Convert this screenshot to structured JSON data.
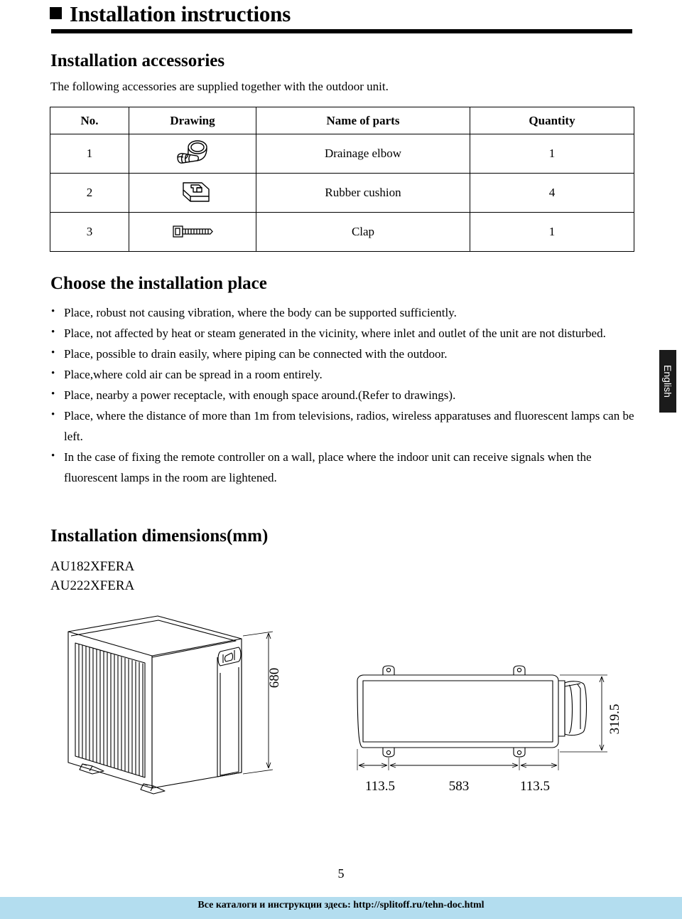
{
  "page": {
    "title": "Installation instructions",
    "page_number": "5",
    "language_tab": "English"
  },
  "accessories_section": {
    "heading": "Installation accessories",
    "intro": "The following accessories are supplied together with the outdoor unit.",
    "table": {
      "headers": [
        "No.",
        "Drawing",
        "Name of parts",
        "Quantity"
      ],
      "rows": [
        {
          "no": "1",
          "drawing_icon": "drainage-elbow-icon",
          "name": "Drainage elbow",
          "quantity": "1"
        },
        {
          "no": "2",
          "drawing_icon": "rubber-cushion-icon",
          "name": "Rubber cushion",
          "quantity": "4"
        },
        {
          "no": "3",
          "drawing_icon": "clap-clamp-icon",
          "name": "Clap",
          "quantity": "1"
        }
      ]
    }
  },
  "place_section": {
    "heading": "Choose the installation place",
    "bullets": [
      "Place, robust not causing vibration, where the body can be supported sufficiently.",
      "Place, not affected by heat or steam generated in the vicinity, where inlet and outlet of the unit are not disturbed.",
      "Place, possible to drain easily, where piping can be connected with the outdoor.",
      "Place,where cold air can be spread in a room entirely.",
      "Place, nearby a power receptacle, with enough space around.(Refer to drawings).",
      "Place, where the distance of more than 1m from televisions, radios, wireless apparatuses and fluorescent lamps can be left.",
      "In the case of fixing the remote controller on a wall, place where the indoor unit can receive signals when the fluorescent lamps in the room are lightened."
    ]
  },
  "dimensions_section": {
    "heading": "Installation dimensions(mm)",
    "models": [
      "AU182XFERA",
      "AU222XFERA"
    ],
    "isometric_view": {
      "height_label": "680"
    },
    "top_view": {
      "depth_label": "319.5",
      "width_labels": [
        "113.5",
        "583",
        "113.5"
      ]
    }
  },
  "footer": {
    "banner_text": "Все каталоги и инструкции здесь: http://splitoff.ru/tehn-doc.html",
    "banner_color": "#b3ddef"
  }
}
